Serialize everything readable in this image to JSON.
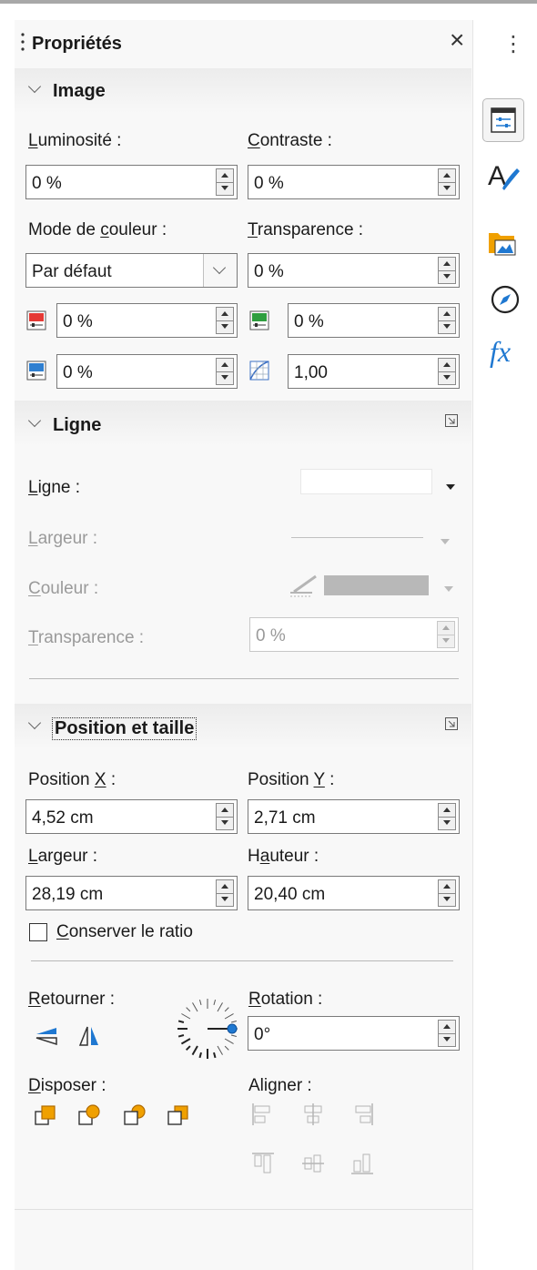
{
  "panel": {
    "title": "Propriétés",
    "close_glyph": "×",
    "menu_glyph": "⋮"
  },
  "image": {
    "title": "Image",
    "brightness": {
      "label": "Luminosité :",
      "value": "0 %"
    },
    "contrast": {
      "label": "Contraste :",
      "value": "0 %"
    },
    "color_mode": {
      "label": "Mode de couleur :",
      "value": "Par défaut"
    },
    "transparency": {
      "label": "Transparence :",
      "value": "0 %"
    },
    "red": {
      "value": "0 %",
      "color": "#e53935"
    },
    "green": {
      "value": "0 %",
      "color": "#2e9e3e"
    },
    "blue": {
      "value": "0 %",
      "color": "#2f7fd0"
    },
    "gamma": {
      "value": "1,00"
    }
  },
  "line": {
    "title": "Ligne",
    "line_label": "Ligne :",
    "width_label": "Largeur :",
    "color_label": "Couleur :",
    "transparency_label": "Transparence :",
    "transparency_value": "0 %"
  },
  "position": {
    "title": "Position et taille",
    "pos_x": {
      "label": "Position X :",
      "value": "4,52 cm"
    },
    "pos_y": {
      "label": "Position Y :",
      "value": "2,71 cm"
    },
    "width": {
      "label": "Largeur :",
      "value": "28,19 cm"
    },
    "height": {
      "label": "Hauteur :",
      "value": "20,40 cm"
    },
    "keep_ratio": {
      "label": "Conserver le ratio",
      "checked": false
    },
    "flip_label": "Retourner :",
    "rotation": {
      "label": "Rotation :",
      "value": "0°"
    },
    "arrange_label": "Disposer :",
    "align_label": "Aligner :"
  },
  "tabs": [
    {
      "name": "properties-tab-icon",
      "active": true
    },
    {
      "name": "styles-tab-icon"
    },
    {
      "name": "gallery-tab-icon"
    },
    {
      "name": "navigator-tab-icon"
    },
    {
      "name": "functions-tab-icon",
      "glyph": "fx"
    }
  ],
  "colors": {
    "accent": "#3a6fc4",
    "panel_bg": "#f8f8f8"
  }
}
